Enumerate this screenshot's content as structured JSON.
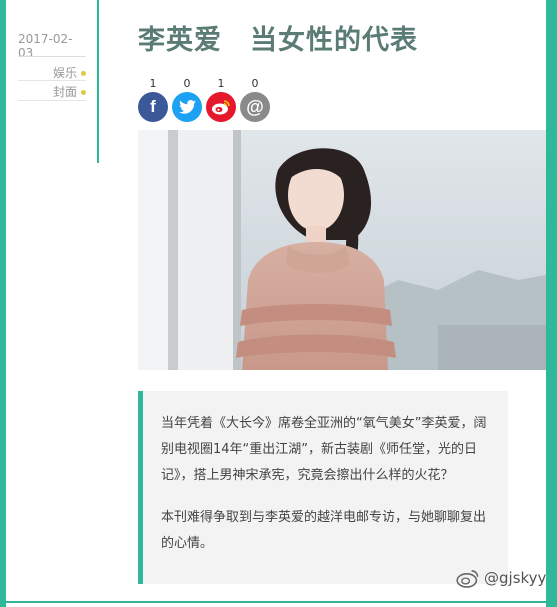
{
  "sidebar": {
    "date": "2017-02-03",
    "tags": [
      {
        "label": "娱乐"
      },
      {
        "label": "封面"
      }
    ]
  },
  "article": {
    "title": "李英爱　当女性的代表",
    "paragraphs": [
      "当年凭着《大长今》席卷全亚洲的“氧气美女”李英爱，阔别电视圈14年“重出江湖”，新古装剧《师任堂，光的日记》，搭上男神宋承宪，究竟会擦出什么样的火花？",
      "本刊难得争取到与李英爱的越洋电邮专访，与她聊聊复出的心情。"
    ]
  },
  "share": {
    "facebook": {
      "count": "1",
      "glyph": "f",
      "color": "#3b5998"
    },
    "twitter": {
      "count": "0",
      "glyph": "t",
      "color": "#1da1f2"
    },
    "weibo": {
      "count": "1",
      "glyph": "w",
      "color": "#e6162d"
    },
    "email": {
      "count": "0",
      "glyph": "@",
      "color": "#8a8a8a"
    }
  },
  "watermark": {
    "text": "@gjskyy",
    "icon": "weibo-icon"
  },
  "colors": {
    "accent": "#2fb99a",
    "title": "#5b7c74"
  }
}
